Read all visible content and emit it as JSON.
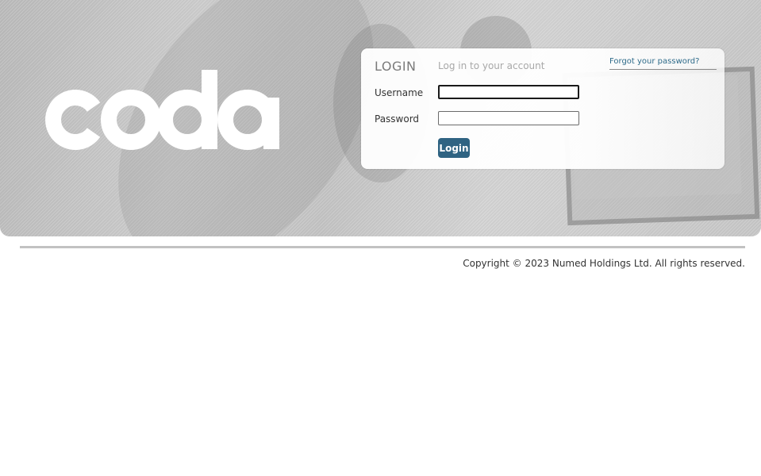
{
  "brand": {
    "logo_text": "coda"
  },
  "login": {
    "title": "LOGIN",
    "subtitle": "Log in to your account",
    "forgot_link": "Forgot your password?",
    "username_label": "Username",
    "username_value": "",
    "password_label": "Password",
    "password_value": "",
    "button_label": "Login"
  },
  "footer": {
    "copyright": "Copyright © 2023 Numed Holdings Ltd. All rights reserved."
  },
  "colors": {
    "accent": "#2f6382",
    "link": "#2e6b8a",
    "divider": "#c2c2c2"
  }
}
